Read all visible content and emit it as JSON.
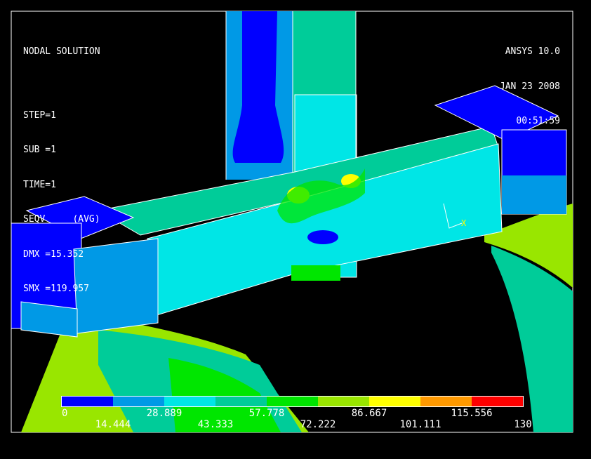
{
  "header": {
    "title": "NODAL SOLUTION",
    "lines": [
      "STEP=1",
      "SUB =1",
      "TIME=1",
      "SEQV     (AVG)",
      "DMX =15.352",
      "SMX =119.957"
    ]
  },
  "stamp": {
    "version": "ANSYS 10.0",
    "date": "JAN 23 2008",
    "time": "00:51:59"
  },
  "triad": {
    "axis": "X"
  },
  "colors": {
    "background": "#000000",
    "band": [
      "#0000ff",
      "#0099e6",
      "#00e6e6",
      "#00cc99",
      "#00e600",
      "#99e600",
      "#ffff00",
      "#ff9900",
      "#ff0000"
    ],
    "outline": "#ffffff"
  },
  "legend": {
    "values": [
      "0",
      "14.444",
      "28.889",
      "43.333",
      "57.778",
      "72.222",
      "86.667",
      "101.111",
      "115.556",
      "130"
    ]
  }
}
